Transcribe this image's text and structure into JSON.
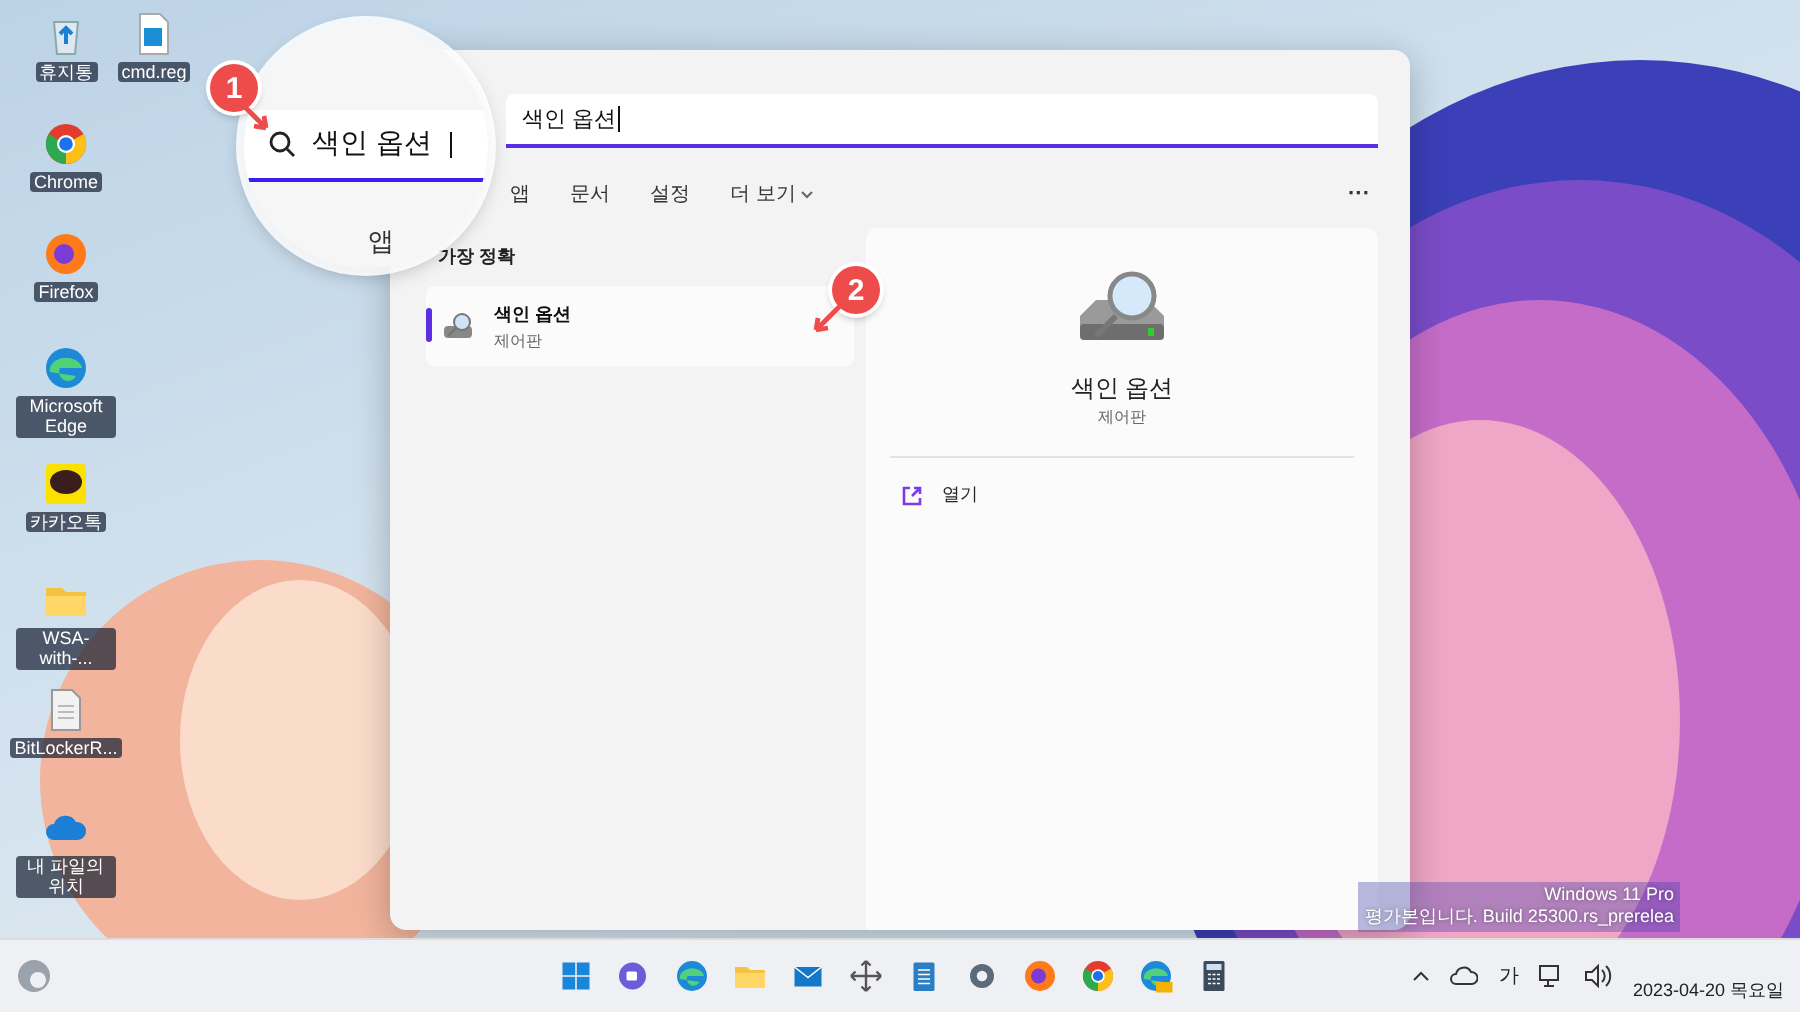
{
  "desktop_icons": [
    {
      "label": "휴지통",
      "kind": "recycle"
    },
    {
      "label": "cmd.reg",
      "kind": "regfile"
    },
    {
      "label": "Chrome",
      "kind": "chrome"
    },
    {
      "label": "Firefox",
      "kind": "firefox"
    },
    {
      "label": "Microsoft Edge",
      "kind": "edge"
    },
    {
      "label": "카카오톡",
      "kind": "talk"
    },
    {
      "label": "WSA-with-...",
      "kind": "folder"
    },
    {
      "label": "BitLockerR...",
      "kind": "document"
    },
    {
      "label": "내 파일의 위치",
      "kind": "cloud"
    }
  ],
  "search": {
    "value": "색인 옵션",
    "filters": [
      {
        "label": "앱",
        "selected": false
      },
      {
        "label": "문서",
        "selected": false
      },
      {
        "label": "설정",
        "selected": false
      },
      {
        "label": "더 보기",
        "selected": false,
        "dropdown": true
      }
    ],
    "more": "···"
  },
  "best_match": {
    "heading": "가장 정확",
    "items": [
      {
        "title": "색인 옵션",
        "subtitle": "제어판",
        "selected": true
      }
    ]
  },
  "detail": {
    "title": "색인 옵션",
    "subtitle": "제어판",
    "actions": [
      {
        "label": "열기"
      }
    ]
  },
  "magnifier": {
    "value": "색인 옵션",
    "tab": "앱"
  },
  "annotations": [
    "1",
    "2"
  ],
  "system_watermark": [
    "Windows 11 Pro",
    "평가본입니다. Build 25300.rs_prerelea"
  ],
  "taskbar": {
    "apps": [
      {
        "kind": "start"
      },
      {
        "kind": "chat"
      },
      {
        "kind": "edge"
      },
      {
        "kind": "explorer"
      },
      {
        "kind": "mail"
      },
      {
        "kind": "move"
      },
      {
        "kind": "notepad"
      },
      {
        "kind": "settings"
      },
      {
        "kind": "firefox"
      },
      {
        "kind": "chrome"
      },
      {
        "kind": "edgecan"
      },
      {
        "kind": "calculator"
      }
    ],
    "ime": "가",
    "date": "2023-04-20 목요일"
  }
}
